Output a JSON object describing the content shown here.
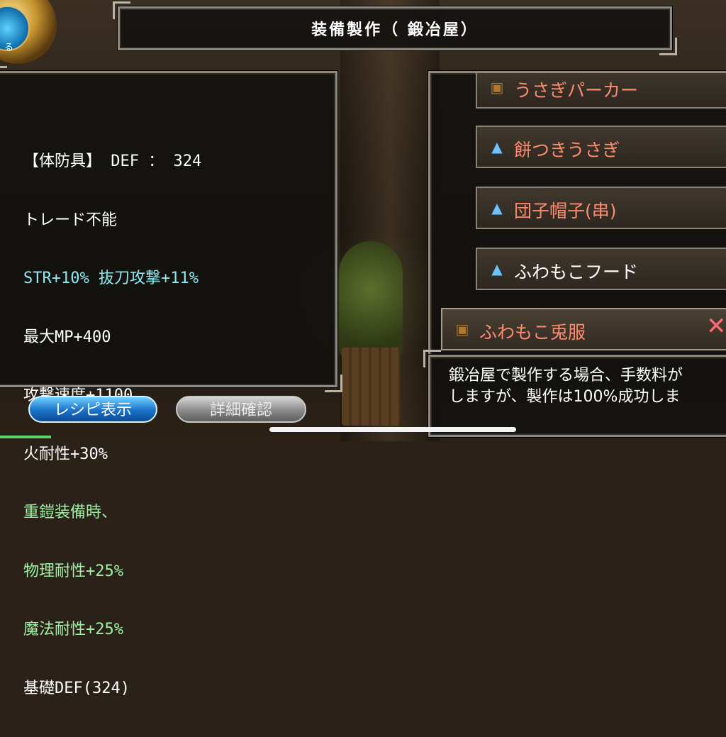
{
  "title": "装備製作（ 鍛冶屋）",
  "stats_lines": [
    {
      "text": "【体防具】 DEF ： 324",
      "color": "white"
    },
    {
      "text": "トレード不能",
      "color": "white"
    },
    {
      "text": "STR+10% 抜刀攻撃+11%",
      "color": "cyan"
    },
    {
      "text": "最大MP+400",
      "color": "white"
    },
    {
      "text": "攻撃速度+1100",
      "color": "white"
    },
    {
      "text": "火耐性+30%",
      "color": "white"
    },
    {
      "text": "重鎧装備時、",
      "color": "green"
    },
    {
      "text": "物理耐性+25%",
      "color": "green"
    },
    {
      "text": "魔法耐性+25%",
      "color": "green"
    },
    {
      "text": "基礎DEF(324)",
      "color": "white"
    }
  ],
  "recipe_list": [
    {
      "label": "うさぎパーカー",
      "icon": "armor-icon",
      "color": "#ff8c6e"
    },
    {
      "label": "餅つきうさぎ",
      "icon": "hat-icon",
      "color": "#ff8c6e"
    },
    {
      "label": "団子帽子(串)",
      "icon": "hat-icon",
      "color": "#ff8c6e"
    },
    {
      "label": "ふわもこフード",
      "icon": "hat-icon",
      "color": "#ffffff"
    },
    {
      "label": "ふわもこ兎服",
      "icon": "armor-icon",
      "color": "#ff8c6e",
      "selected": true
    }
  ],
  "message": {
    "line1": "鍛冶屋で製作する場合、手数料が",
    "line2": "しますが、製作は100%成功しま"
  },
  "buttons": {
    "recipe": "レシピ表示",
    "detail": "詳細確認"
  },
  "corner_label": "る"
}
